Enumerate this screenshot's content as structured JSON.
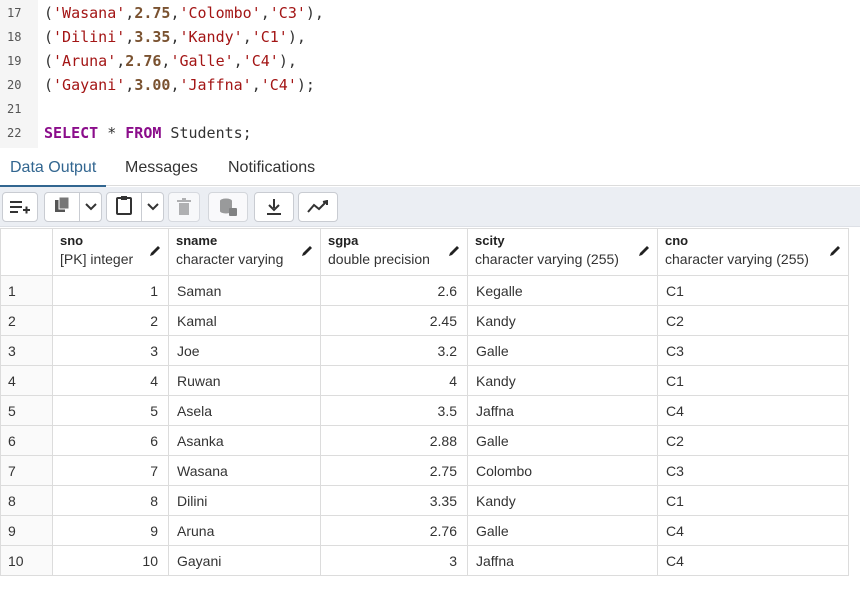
{
  "editor": {
    "lines": [
      {
        "num": "17",
        "tokens": [
          {
            "t": "punc",
            "v": "("
          },
          {
            "t": "str",
            "v": "'Wasana'"
          },
          {
            "t": "punc",
            "v": ","
          },
          {
            "t": "num",
            "v": "2.75"
          },
          {
            "t": "punc",
            "v": ","
          },
          {
            "t": "str",
            "v": "'Colombo'"
          },
          {
            "t": "punc",
            "v": ","
          },
          {
            "t": "str",
            "v": "'C3'"
          },
          {
            "t": "punc",
            "v": "),"
          }
        ]
      },
      {
        "num": "18",
        "tokens": [
          {
            "t": "punc",
            "v": "("
          },
          {
            "t": "str",
            "v": "'Dilini'"
          },
          {
            "t": "punc",
            "v": ","
          },
          {
            "t": "num",
            "v": "3.35"
          },
          {
            "t": "punc",
            "v": ","
          },
          {
            "t": "str",
            "v": "'Kandy'"
          },
          {
            "t": "punc",
            "v": ","
          },
          {
            "t": "str",
            "v": "'C1'"
          },
          {
            "t": "punc",
            "v": "),"
          }
        ]
      },
      {
        "num": "19",
        "tokens": [
          {
            "t": "punc",
            "v": "("
          },
          {
            "t": "str",
            "v": "'Aruna'"
          },
          {
            "t": "punc",
            "v": ","
          },
          {
            "t": "num",
            "v": "2.76"
          },
          {
            "t": "punc",
            "v": ","
          },
          {
            "t": "str",
            "v": "'Galle'"
          },
          {
            "t": "punc",
            "v": ","
          },
          {
            "t": "str",
            "v": "'C4'"
          },
          {
            "t": "punc",
            "v": "),"
          }
        ]
      },
      {
        "num": "20",
        "tokens": [
          {
            "t": "punc",
            "v": "("
          },
          {
            "t": "str",
            "v": "'Gayani'"
          },
          {
            "t": "punc",
            "v": ","
          },
          {
            "t": "num",
            "v": "3.00"
          },
          {
            "t": "punc",
            "v": ","
          },
          {
            "t": "str",
            "v": "'Jaffna'"
          },
          {
            "t": "punc",
            "v": ","
          },
          {
            "t": "str",
            "v": "'C4'"
          },
          {
            "t": "punc",
            "v": ");"
          }
        ]
      },
      {
        "num": "21",
        "tokens": []
      },
      {
        "num": "22",
        "tokens": [
          {
            "t": "kw",
            "v": "SELECT"
          },
          {
            "t": "punc",
            "v": " * "
          },
          {
            "t": "kw",
            "v": "FROM"
          },
          {
            "t": "punc",
            "v": " Students;"
          }
        ]
      }
    ]
  },
  "tabs": [
    {
      "label": "Data Output",
      "active": true
    },
    {
      "label": "Messages",
      "active": false
    },
    {
      "label": "Notifications",
      "active": false
    }
  ],
  "toolbar": {
    "icons": [
      "add-row-icon",
      "copy-icon",
      "chevron-down-icon",
      "paste-icon",
      "chevron-down-icon",
      "delete-icon",
      "save-data-icon",
      "download-icon",
      "graph-visualiser-icon"
    ]
  },
  "grid": {
    "columns": [
      {
        "name": "sno",
        "type": "[PK] integer",
        "align": "right"
      },
      {
        "name": "sname",
        "type": "character varying",
        "align": "left"
      },
      {
        "name": "sgpa",
        "type": "double precision",
        "align": "right"
      },
      {
        "name": "scity",
        "type": "character varying (255)",
        "align": "left"
      },
      {
        "name": "cno",
        "type": "character varying (255)",
        "align": "left"
      }
    ],
    "rows": [
      {
        "index": "1",
        "cells": [
          "1",
          "Saman",
          "2.6",
          "Kegalle",
          "C1"
        ]
      },
      {
        "index": "2",
        "cells": [
          "2",
          "Kamal",
          "2.45",
          "Kandy",
          "C2"
        ]
      },
      {
        "index": "3",
        "cells": [
          "3",
          "Joe",
          "3.2",
          "Galle",
          "C3"
        ]
      },
      {
        "index": "4",
        "cells": [
          "4",
          "Ruwan",
          "4",
          "Kandy",
          "C1"
        ]
      },
      {
        "index": "5",
        "cells": [
          "5",
          "Asela",
          "3.5",
          "Jaffna",
          "C4"
        ]
      },
      {
        "index": "6",
        "cells": [
          "6",
          "Asanka",
          "2.88",
          "Galle",
          "C2"
        ]
      },
      {
        "index": "7",
        "cells": [
          "7",
          "Wasana",
          "2.75",
          "Colombo",
          "C3"
        ]
      },
      {
        "index": "8",
        "cells": [
          "8",
          "Dilini",
          "3.35",
          "Kandy",
          "C1"
        ]
      },
      {
        "index": "9",
        "cells": [
          "9",
          "Aruna",
          "2.76",
          "Galle",
          "C4"
        ]
      },
      {
        "index": "10",
        "cells": [
          "10",
          "Gayani",
          "3",
          "Jaffna",
          "C4"
        ]
      }
    ]
  }
}
